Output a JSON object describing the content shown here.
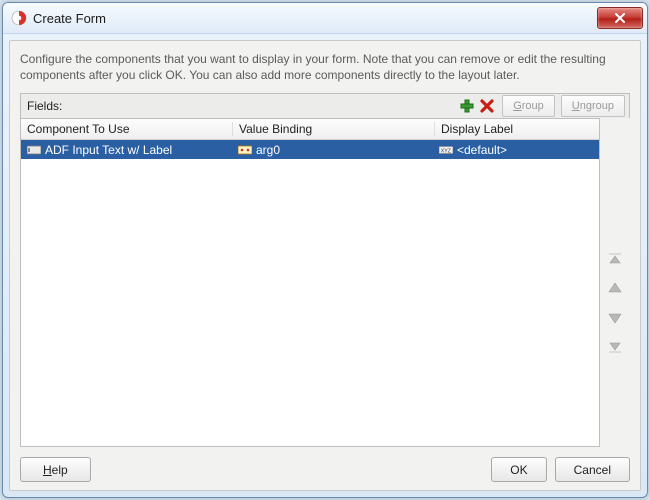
{
  "window": {
    "title": "Create Form"
  },
  "description": "Configure the components that you want to display in your form. Note that you can remove or edit the resulting components after you click OK. You can also add more components directly to the layout later.",
  "fields": {
    "label": "Fields:",
    "group_btn": "Group",
    "ungroup_btn": "Ungroup",
    "columns": {
      "component": "Component To Use",
      "binding": "Value Binding",
      "label": "Display Label"
    },
    "rows": [
      {
        "component": "ADF Input Text w/ Label",
        "binding": "arg0",
        "label": "<default>"
      }
    ]
  },
  "buttons": {
    "help": "Help",
    "ok": "OK",
    "cancel": "Cancel"
  }
}
